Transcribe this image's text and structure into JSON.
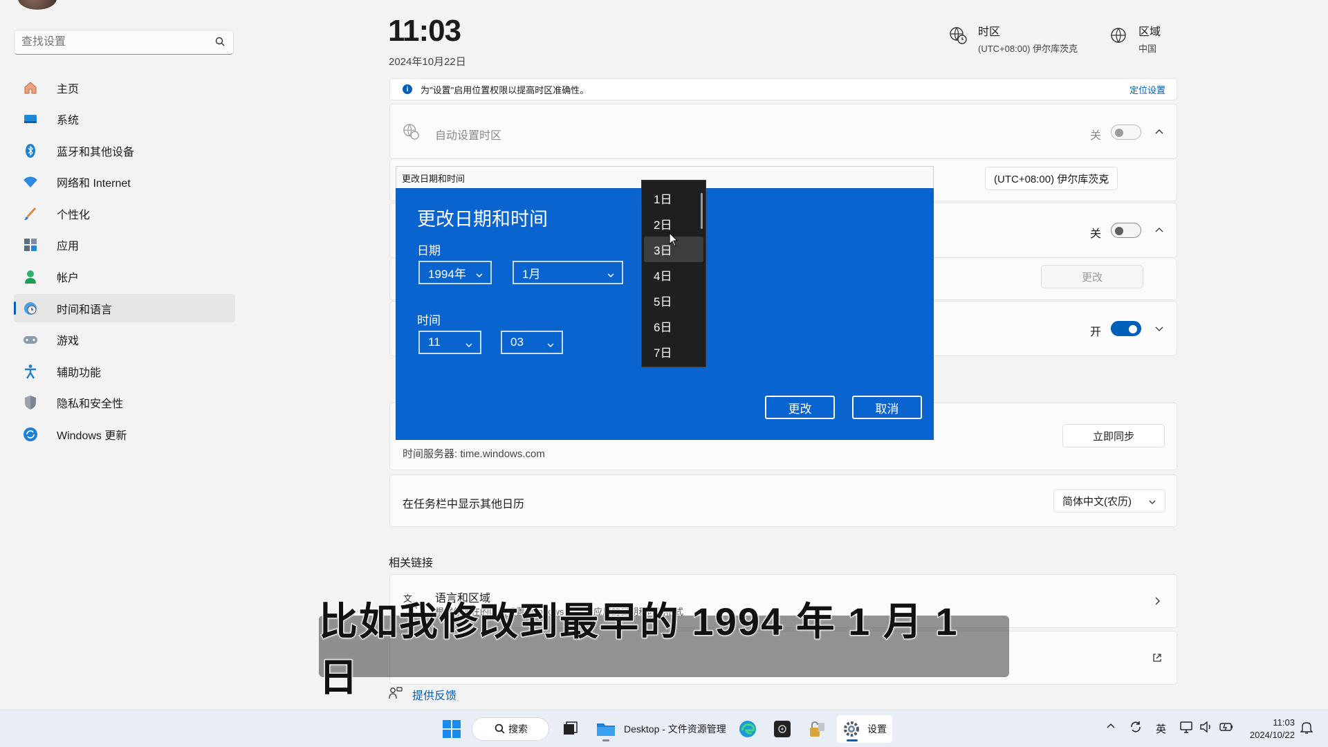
{
  "sidebar": {
    "search_placeholder": "查找设置",
    "items": [
      {
        "label": "主页",
        "icon": "home-icon"
      },
      {
        "label": "系统",
        "icon": "monitor-icon"
      },
      {
        "label": "蓝牙和其他设备",
        "icon": "bluetooth-icon"
      },
      {
        "label": "网络和 Internet",
        "icon": "wifi-icon"
      },
      {
        "label": "个性化",
        "icon": "brush-icon"
      },
      {
        "label": "应用",
        "icon": "apps-icon"
      },
      {
        "label": "帐户",
        "icon": "person-icon"
      },
      {
        "label": "时间和语言",
        "icon": "clock-globe-icon",
        "active": true
      },
      {
        "label": "游戏",
        "icon": "gamepad-icon"
      },
      {
        "label": "辅助功能",
        "icon": "accessibility-icon"
      },
      {
        "label": "隐私和安全性",
        "icon": "shield-icon"
      },
      {
        "label": "Windows 更新",
        "icon": "update-icon"
      }
    ]
  },
  "header": {
    "time": "11:03",
    "date": "2024年10月22日",
    "timezone_title": "时区",
    "timezone_value": "(UTC+08:00) 伊尔库茨克",
    "region_title": "区域",
    "region_value": "中国"
  },
  "infobar": {
    "text": "为\"设置\"启用位置权限以提高时区准确性。",
    "link": "定位设置"
  },
  "settings": {
    "auto_timezone_label": "自动设置时区",
    "auto_timezone_state": "关",
    "timezone_dropdown": "(UTC+08:00) 伊尔库茨克",
    "auto_time_state": "关",
    "change_button": "更改",
    "dst_state": "开",
    "time_server": "时间服务器: time.windows.com",
    "sync_now": "立即同步",
    "other_calendar_label": "在任务栏中显示其他日历",
    "other_calendar_value": "简体中文(农历)",
    "related_links_header": "相关链接",
    "language_region_title": "语言和区域",
    "language_region_desc": "根据你所在的区域设置 Windows 和某些应用的日期和时间格式",
    "feedback": "提供反馈"
  },
  "dialog": {
    "window_title": "更改日期和时间",
    "heading": "更改日期和时间",
    "date_label": "日期",
    "year": "1994年",
    "month": "1月",
    "time_label": "时间",
    "hour": "11",
    "minute": "03",
    "ok": "更改",
    "cancel": "取消",
    "day_options": [
      "1日",
      "2日",
      "3日",
      "4日",
      "5日",
      "6日",
      "7日"
    ],
    "hovered_day": "3日"
  },
  "caption": {
    "text": "比如我修改到最早的 1994 年 1 月 1 日"
  },
  "taskbar": {
    "search_label": "搜索",
    "explorer_label": "Desktop - 文件资源管理",
    "settings_label": "设置",
    "ime": "英",
    "time": "11:03",
    "date": "2024/10/22"
  },
  "colors": {
    "accent": "#005fb8",
    "dialog_bg": "#0a64cf"
  }
}
